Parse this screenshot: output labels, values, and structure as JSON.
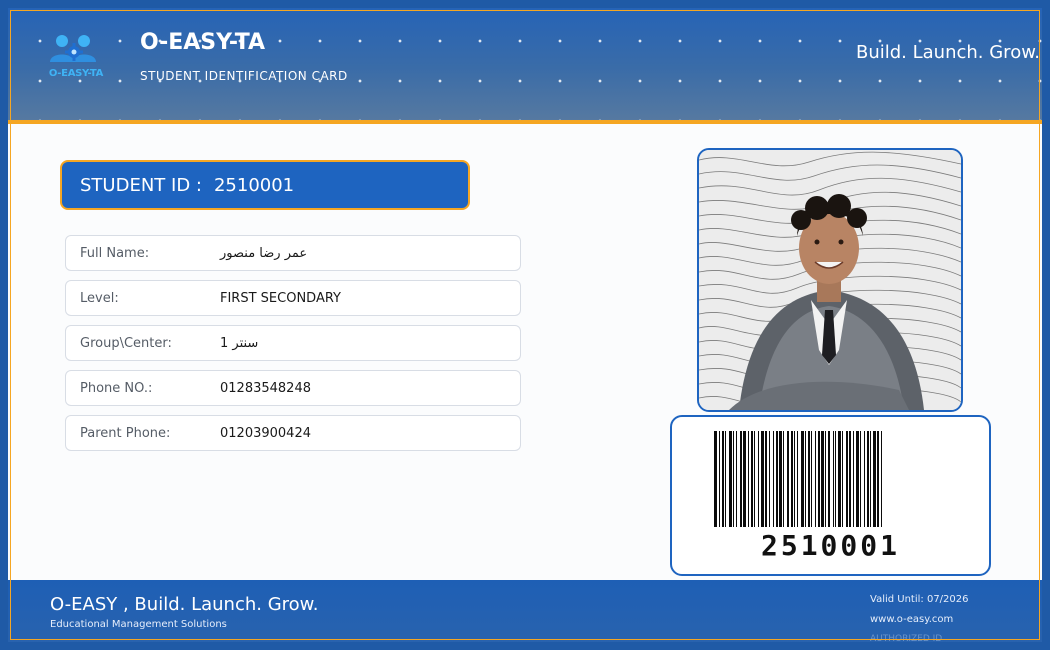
{
  "header": {
    "logo_text": "O-EASY-TA",
    "title": "O-EASY-TA",
    "subtitle": "STUDENT IDENTIFICATION CARD",
    "tagline": "Build. Launch. Grow."
  },
  "student_id": {
    "label": "STUDENT ID :",
    "value": "2510001"
  },
  "fields": [
    {
      "label": "Full Name:",
      "value": "عمر رضا منصور"
    },
    {
      "label": "Level:",
      "value": "FIRST SECONDARY"
    },
    {
      "label": "Group\\Center:",
      "value": "1 سنتر"
    },
    {
      "label": "Phone NO.:",
      "value": "01283548248"
    },
    {
      "label": "Parent Phone:",
      "value": "01203900424"
    }
  ],
  "barcode": {
    "number": "2510001"
  },
  "footer": {
    "title": "O-EASY , Build. Launch. Grow.",
    "subtitle": "Educational Management Solutions",
    "valid_until": "Valid Until: 07/2026",
    "website": "www.o-easy.com",
    "authorized": "AUTHORIZED ID"
  },
  "colors": {
    "primary_blue": "#1e64c0",
    "accent_orange": "#f5a623",
    "logo_cyan": "#3fb3f5"
  }
}
